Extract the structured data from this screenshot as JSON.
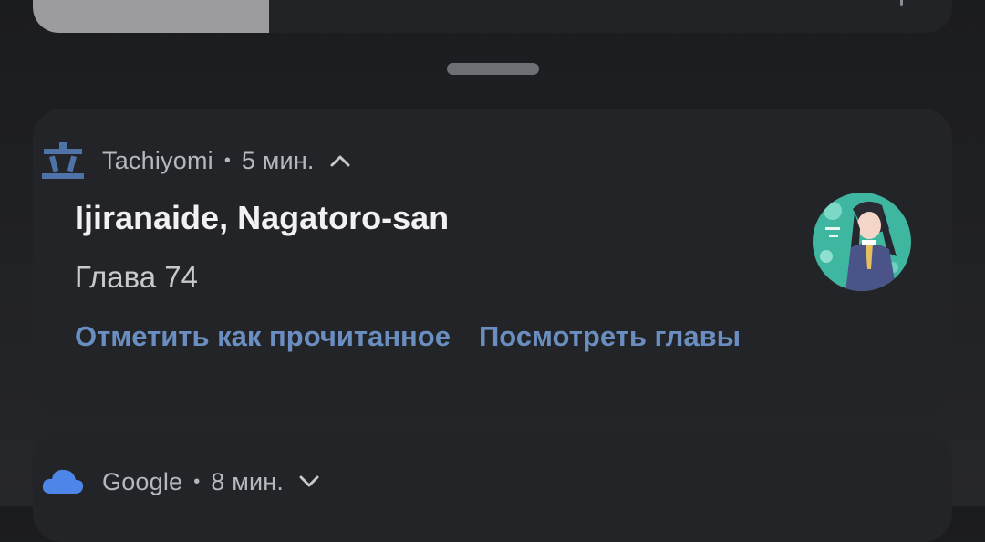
{
  "notification": {
    "app_name": "Tachiyomi",
    "separator": "•",
    "time": "5 мин.",
    "title": "Ijiranaide, Nagatoro-san",
    "subtitle": "Глава 74",
    "actions": [
      "Отметить как прочитанное",
      "Посмотреть главы"
    ],
    "app_icon": "tachiyomi-logo-icon",
    "expand_icon": "chevron-up-icon",
    "accent_color": "#6a8ec0"
  },
  "second_notification": {
    "app_name": "Google",
    "separator": "•",
    "time": "8 мин.",
    "app_icon": "cloud-icon",
    "expand_icon": "chevron-down-icon",
    "icon_color": "#4d86e8"
  }
}
